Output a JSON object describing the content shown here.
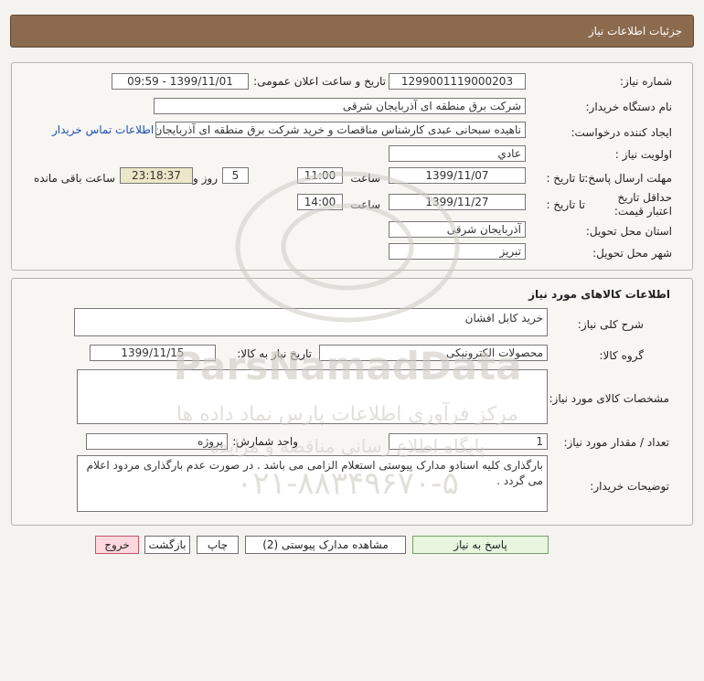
{
  "header": {
    "title": "جزئیات اطلاعات نیاز"
  },
  "details": {
    "need_number_label": "شماره نیاز:",
    "need_number": "1299001119000203",
    "announce_label": "تاریخ و ساعت اعلان عمومی:",
    "announce_value": "1399/11/01 - 09:59",
    "buyer_org_label": "نام دستگاه خریدار:",
    "buyer_org": "شرکت برق منطقه ای آذربایجان شرقی",
    "requester_label": "ایجاد کننده درخواست:",
    "requester": "ناهیده  سبحانی عبدی کارشناس مناقصات و خرید شرکت برق منطقه ای آذربایجان شرقی",
    "contact_link": "اطلاعات تماس خریدار",
    "priority_label": "اولویت نیاز :",
    "priority": "عادي",
    "deadline_label": "مهلت ارسال پاسخ:",
    "until_date_label": "تا تاریخ :",
    "deadline_date": "1399/11/07",
    "time_label": "ساعت",
    "deadline_time": "11:00",
    "days_value": "5",
    "days_label": "روز و",
    "remaining_time": "23:18:37",
    "remaining_label": "ساعت باقی مانده",
    "validity_label": "حداقل تاریخ اعتبار قیمت:",
    "validity_until_label": "تا تاریخ :",
    "validity_date": "1399/11/27",
    "validity_time_label": "ساعت",
    "validity_time": "14:00",
    "province_label": "استان محل تحویل:",
    "province": "آذربایجان شرقی",
    "city_label": "شهر محل تحویل:",
    "city": "تبریز"
  },
  "goods": {
    "section_title": "اطلاعات کالاهای مورد نیاز",
    "description_label": "شرح کلی نیاز:",
    "description": "خرید کابل افشان",
    "group_label": "گروه کالا:",
    "group": "محصولات الکترونیکی",
    "need_date_label": "تاریخ نیاز به کالا:",
    "need_date": "1399/11/15",
    "specs_label": "مشخصات کالای مورد نیاز:",
    "specs": "",
    "qty_label": "تعداد / مقدار مورد نیاز:",
    "qty": "1",
    "unit_label": "واحد شمارش:",
    "unit": "پروژه",
    "buyer_notes_label": "توضیحات خریدار:",
    "buyer_notes": "بارگذاری کلیه اسنادو مدارک پیوستی استعلام الزامی می باشد . در صورت عدم بارگذاری مردود اعلام می گردد ."
  },
  "actions": {
    "reply": "پاسخ به نیاز",
    "view_attachments": "مشاهده مدارک پیوستی (2)",
    "print": "چاپ",
    "back": "بازگشت",
    "exit": "خروج"
  },
  "watermark": {
    "line1": "ParsNamadData",
    "line2": "مرکز فرآوری اطلاعات پارس نماد داده ها",
    "line3": "پایگاه اطلاع رسانی مناقصه و مزایده",
    "phone": "۰۲۱-۸۸۳۴۹۶۷۰-۵"
  },
  "colors": {
    "title_bar": "#8b6a4e",
    "remaining_highlight": "#ece7c8",
    "link": "#1b4fb0",
    "reply_button": "#e8f5df",
    "exit_button": "#ffd8de"
  }
}
